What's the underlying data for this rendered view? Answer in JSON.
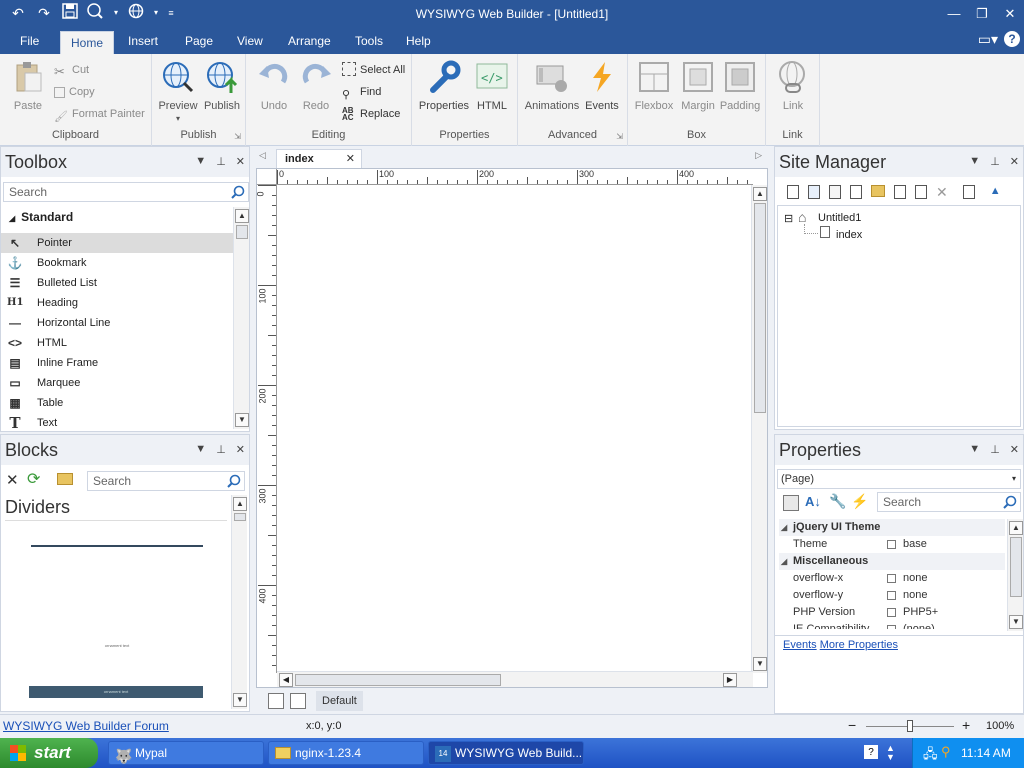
{
  "window": {
    "title": "WYSIWYG Web Builder - [Untitled1]"
  },
  "menu": {
    "tabs": [
      "File",
      "Home",
      "Insert",
      "Page",
      "View",
      "Arrange",
      "Tools",
      "Help"
    ]
  },
  "ribbon": {
    "clipboard": {
      "label": "Clipboard",
      "paste": "Paste",
      "cut": "Cut",
      "copy": "Copy",
      "format_painter": "Format Painter"
    },
    "publish": {
      "label": "Publish",
      "preview": "Preview",
      "publish": "Publish"
    },
    "editing": {
      "label": "Editing",
      "undo": "Undo",
      "redo": "Redo",
      "select_all": "Select All",
      "find": "Find",
      "replace": "Replace"
    },
    "properties": {
      "label": "Properties",
      "properties": "Properties",
      "html": "HTML"
    },
    "advanced": {
      "label": "Advanced",
      "animations": "Animations",
      "events": "Events"
    },
    "box": {
      "label": "Box",
      "flexbox": "Flexbox",
      "margin": "Margin",
      "padding": "Padding"
    },
    "link": {
      "label": "Link",
      "link": "Link"
    }
  },
  "toolbox": {
    "title": "Toolbox",
    "search_placeholder": "Search",
    "category": "Standard",
    "items": [
      {
        "label": "Pointer",
        "icon": "pointer-icon"
      },
      {
        "label": "Bookmark",
        "icon": "anchor-icon"
      },
      {
        "label": "Bulleted List",
        "icon": "list-icon"
      },
      {
        "label": "Heading",
        "icon": "heading-icon"
      },
      {
        "label": "Horizontal Line",
        "icon": "line-icon"
      },
      {
        "label": "HTML",
        "icon": "code-icon"
      },
      {
        "label": "Inline Frame",
        "icon": "frame-icon"
      },
      {
        "label": "Marquee",
        "icon": "marquee-icon"
      },
      {
        "label": "Table",
        "icon": "table-icon"
      },
      {
        "label": "Text",
        "icon": "text-icon"
      }
    ]
  },
  "blocks": {
    "title": "Blocks",
    "search_placeholder": "Search",
    "category": "Dividers",
    "divider_sample": "ornament text",
    "divider_bar": "ornament text"
  },
  "document": {
    "tab": "index",
    "ruler_h": [
      "0",
      "100",
      "200",
      "300",
      "400"
    ],
    "ruler_v": [
      "0",
      "100",
      "200",
      "300",
      "400"
    ],
    "page_button": "Default"
  },
  "site_manager": {
    "title": "Site Manager",
    "root": "Untitled1",
    "page": "index"
  },
  "properties": {
    "title": "Properties",
    "selected": "(Page)",
    "search_placeholder": "Search",
    "rows": [
      {
        "type": "cat",
        "name": "jQuery UI Theme"
      },
      {
        "type": "prop",
        "name": "Theme",
        "value": "base"
      },
      {
        "type": "cat",
        "name": "Miscellaneous"
      },
      {
        "type": "prop",
        "name": "overflow-x",
        "value": "none"
      },
      {
        "type": "prop",
        "name": "overflow-y",
        "value": "none"
      },
      {
        "type": "prop",
        "name": "PHP Version",
        "value": "PHP5+"
      },
      {
        "type": "prop",
        "name": "IE Compatibility",
        "value": "(none)"
      }
    ],
    "links": {
      "events": "Events",
      "more": "More Properties"
    }
  },
  "status": {
    "forum_link": "WYSIWYG Web Builder Forum",
    "coords": "x:0, y:0",
    "zoom": "100%",
    "zoom_level": 0.5
  },
  "taskbar": {
    "start": "start",
    "buttons": [
      "Mypal",
      "nginx-1.23.4",
      "WYSIWYG Web Build..."
    ],
    "clock": "11:14 AM"
  },
  "colors": {
    "accent": "#2b579a",
    "taskbar": "#2458d4",
    "start": "#3a9a3a"
  }
}
